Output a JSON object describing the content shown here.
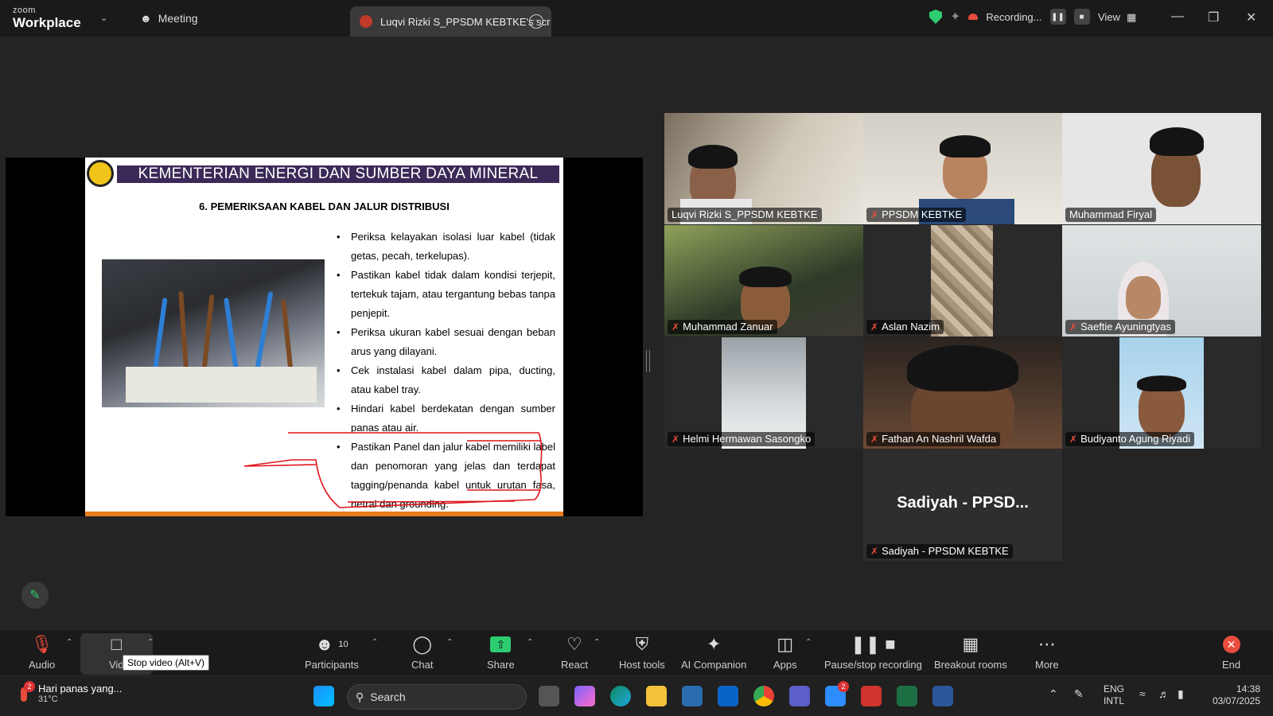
{
  "app": {
    "brand_top": "zoom",
    "brand_bottom": "Workplace",
    "meeting_label": "Meeting"
  },
  "share_tab": {
    "title": "Luqvi Rizki S_PPSDM KEBTKE's scr"
  },
  "status": {
    "recording_label": "Recording...",
    "view_label": "View",
    "shield_color": "#2ecc71"
  },
  "slide": {
    "header": "KEMENTERIAN ENERGI DAN SUMBER DAYA MINERAL",
    "subtitle": "6. PEMERIKSAAN KABEL DAN JALUR DISTRIBUSI",
    "bullets": [
      "Periksa kelayakan isolasi luar kabel (tidak getas, pecah, terkelupas).",
      "Pastikan kabel tidak dalam kondisi terjepit, tertekuk tajam, atau tergantung bebas tanpa penjepit.",
      "Periksa ukuran kabel sesuai dengan beban arus yang dilayani.",
      "Cek instalasi kabel dalam pipa, ducting, atau kabel tray.",
      "Hindari kabel berdekatan dengan sumber panas atau air.",
      "Pastikan Panel dan jalur kabel memiliki label dan penomoran yang jelas dan terdapat tagging/penanda kabel untuk urutan fasa, netral dan grounding."
    ]
  },
  "participants_grid": [
    {
      "name": "Luqvi Rizki S_PPSDM KEBTKE",
      "muted": false,
      "active": false
    },
    {
      "name": "PPSDM KEBTKE",
      "muted": true,
      "active": false
    },
    {
      "name": "Muhammad Firyal",
      "muted": false,
      "active": true
    },
    {
      "name": "Muhammad Zanuar",
      "muted": true,
      "active": false
    },
    {
      "name": "Aslan Nazim",
      "muted": true,
      "active": false
    },
    {
      "name": "Saeftie Ayuningtyas",
      "muted": true,
      "active": false
    },
    {
      "name": "Helmi Hermawan Sasongko",
      "muted": true,
      "active": false
    },
    {
      "name": "Fathan An Nashril Wafda",
      "muted": true,
      "active": false
    },
    {
      "name": "Budiyanto Agung Riyadi",
      "muted": true,
      "active": false
    },
    {
      "name": "Sadiyah - PPSDM KEBTKE",
      "muted": true,
      "active": false,
      "big_label": "Sadiyah - PPSD..."
    }
  ],
  "toolbar": {
    "audio": "Audio",
    "video": "Vid",
    "video_tooltip": "Stop video (Alt+V)",
    "participants": "Participants",
    "participants_count": "10",
    "chat": "Chat",
    "share": "Share",
    "react": "React",
    "host_tools": "Host tools",
    "ai_companion": "AI Companion",
    "apps": "Apps",
    "pause_recording": "Pause/stop recording",
    "breakout": "Breakout rooms",
    "more": "More",
    "end": "End"
  },
  "taskbar": {
    "weather_text": "Hari panas yang...",
    "weather_temp": "31°C",
    "weather_badge": "2",
    "search_placeholder": "Search",
    "zoom_badge": "2",
    "lang_top": "ENG",
    "lang_bottom": "INTL",
    "time": "14:38",
    "date": "03/07/2025"
  }
}
